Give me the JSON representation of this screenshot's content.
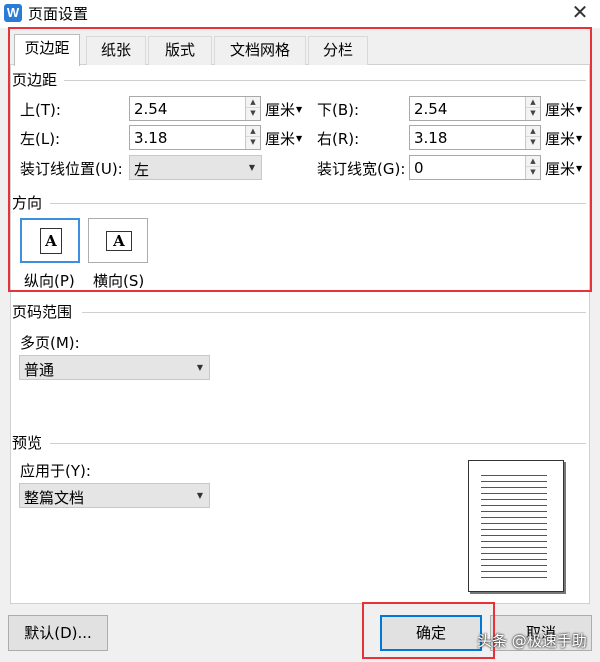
{
  "window": {
    "title": "页面设置",
    "app_icon_letter": "W",
    "close_glyph": "✕"
  },
  "tabs": [
    {
      "label": "页边距",
      "active": true
    },
    {
      "label": "纸张",
      "active": false
    },
    {
      "label": "版式",
      "active": false
    },
    {
      "label": "文档网格",
      "active": false
    },
    {
      "label": "分栏",
      "active": false
    }
  ],
  "margins": {
    "group_label": "页边距",
    "top": {
      "label": "上(T):",
      "value": "2.54",
      "unit": "厘米"
    },
    "bottom": {
      "label": "下(B):",
      "value": "2.54",
      "unit": "厘米"
    },
    "left": {
      "label": "左(L):",
      "value": "3.18",
      "unit": "厘米"
    },
    "right": {
      "label": "右(R):",
      "value": "3.18",
      "unit": "厘米"
    },
    "gutter_position": {
      "label": "装订线位置(U):",
      "value": "左"
    },
    "gutter_width": {
      "label": "装订线宽(G):",
      "value": "0",
      "unit": "厘米"
    }
  },
  "orientation": {
    "group_label": "方向",
    "portrait": {
      "label": "纵向(P)",
      "glyph": "A",
      "selected": true
    },
    "landscape": {
      "label": "横向(S)",
      "glyph": "A",
      "selected": false
    }
  },
  "page_range": {
    "group_label": "页码范围",
    "multiple_pages_label": "多页(M):",
    "multiple_pages_value": "普通"
  },
  "preview": {
    "group_label": "预览",
    "apply_to_label": "应用于(Y):",
    "apply_to_value": "整篇文档"
  },
  "buttons": {
    "default": "默认(D)...",
    "ok": "确定",
    "cancel": "取消"
  },
  "watermark": "头条 @极速手助",
  "colors": {
    "highlight_red": "#e8323a",
    "focus_blue": "#0078d7"
  }
}
